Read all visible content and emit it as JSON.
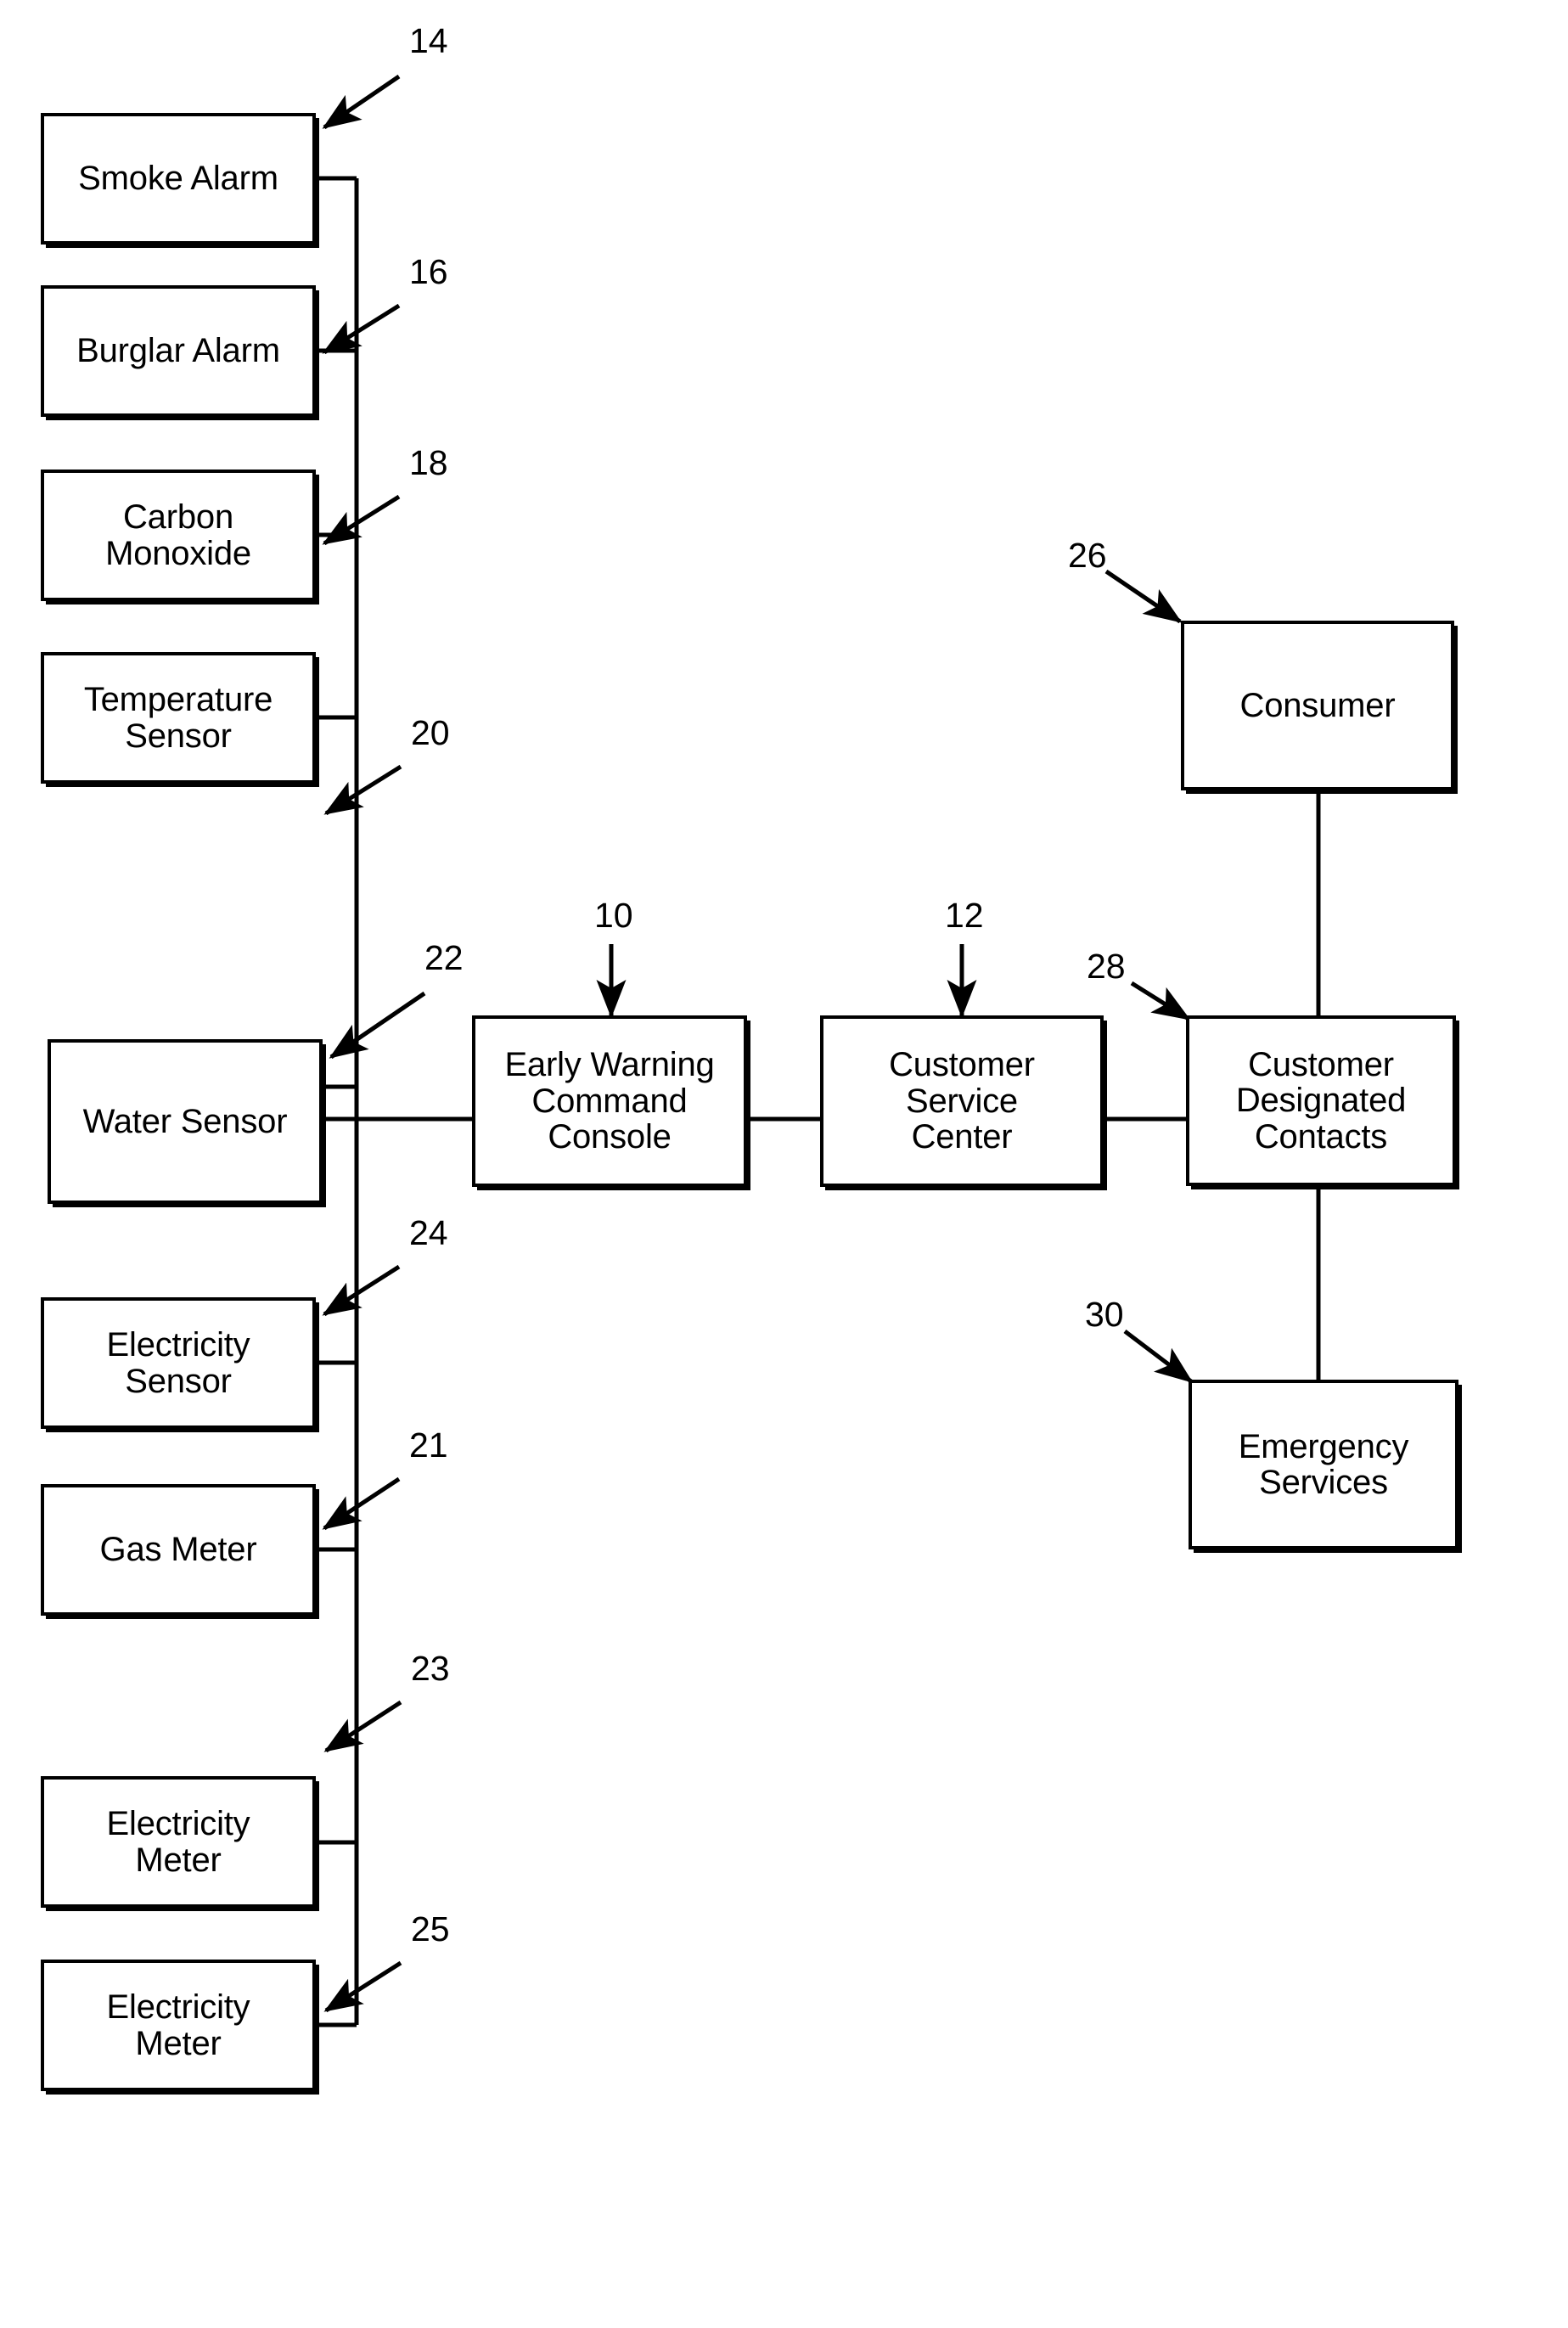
{
  "figure": {
    "type": "patent-block-diagram",
    "background_color": "#ffffff",
    "line_color": "#000000"
  },
  "nodes": [
    {
      "id": "smoke_alarm",
      "label": "Smoke Alarm",
      "ref": "14"
    },
    {
      "id": "burglar_alarm",
      "label": "Burglar Alarm",
      "ref": "16"
    },
    {
      "id": "carbon_monoxide",
      "label": "Carbon\nMonoxide",
      "ref": "18"
    },
    {
      "id": "temperature",
      "label": "Temperature\nSensor",
      "ref": "20"
    },
    {
      "id": "water_sensor",
      "label": "Water Sensor",
      "ref": "22"
    },
    {
      "id": "electricity_sensor",
      "label": "Electricity\nSensor",
      "ref": "24"
    },
    {
      "id": "gas_meter",
      "label": "Gas Meter",
      "ref": "21"
    },
    {
      "id": "electricity_meter_1",
      "label": "Electricity\nMeter",
      "ref": "23"
    },
    {
      "id": "electricity_meter_2",
      "label": "Electricity\nMeter",
      "ref": "25"
    },
    {
      "id": "command_console",
      "label": "Early Warning\nCommand\nConsole",
      "ref": "10"
    },
    {
      "id": "service_center",
      "label": "Customer\nService\nCenter",
      "ref": "12"
    },
    {
      "id": "consumer",
      "label": "Consumer",
      "ref": "26"
    },
    {
      "id": "designated_contacts",
      "label": "Customer\nDesignated\nContacts",
      "ref": "28"
    },
    {
      "id": "emergency_services",
      "label": "Emergency\nServices",
      "ref": "30"
    }
  ],
  "reference_numerals": {
    "n10": "10",
    "n12": "12",
    "n14": "14",
    "n16": "16",
    "n18": "18",
    "n20": "20",
    "n21": "21",
    "n22": "22",
    "n23": "23",
    "n24": "24",
    "n25": "25",
    "n26": "26",
    "n28": "28",
    "n30": "30"
  },
  "connections": [
    {
      "from": "sensor_bus",
      "to": "command_console"
    },
    {
      "from": "smoke_alarm",
      "to": "sensor_bus"
    },
    {
      "from": "burglar_alarm",
      "to": "sensor_bus"
    },
    {
      "from": "carbon_monoxide",
      "to": "sensor_bus"
    },
    {
      "from": "temperature",
      "to": "sensor_bus"
    },
    {
      "from": "water_sensor",
      "to": "command_console"
    },
    {
      "from": "electricity_sensor",
      "to": "sensor_bus"
    },
    {
      "from": "gas_meter",
      "to": "sensor_bus"
    },
    {
      "from": "electricity_meter_1",
      "to": "sensor_bus"
    },
    {
      "from": "electricity_meter_2",
      "to": "sensor_bus"
    },
    {
      "from": "command_console",
      "to": "service_center"
    },
    {
      "from": "service_center",
      "to": "designated_contacts"
    },
    {
      "from": "consumer",
      "to": "designated_contacts"
    },
    {
      "from": "designated_contacts",
      "to": "emergency_services"
    }
  ]
}
